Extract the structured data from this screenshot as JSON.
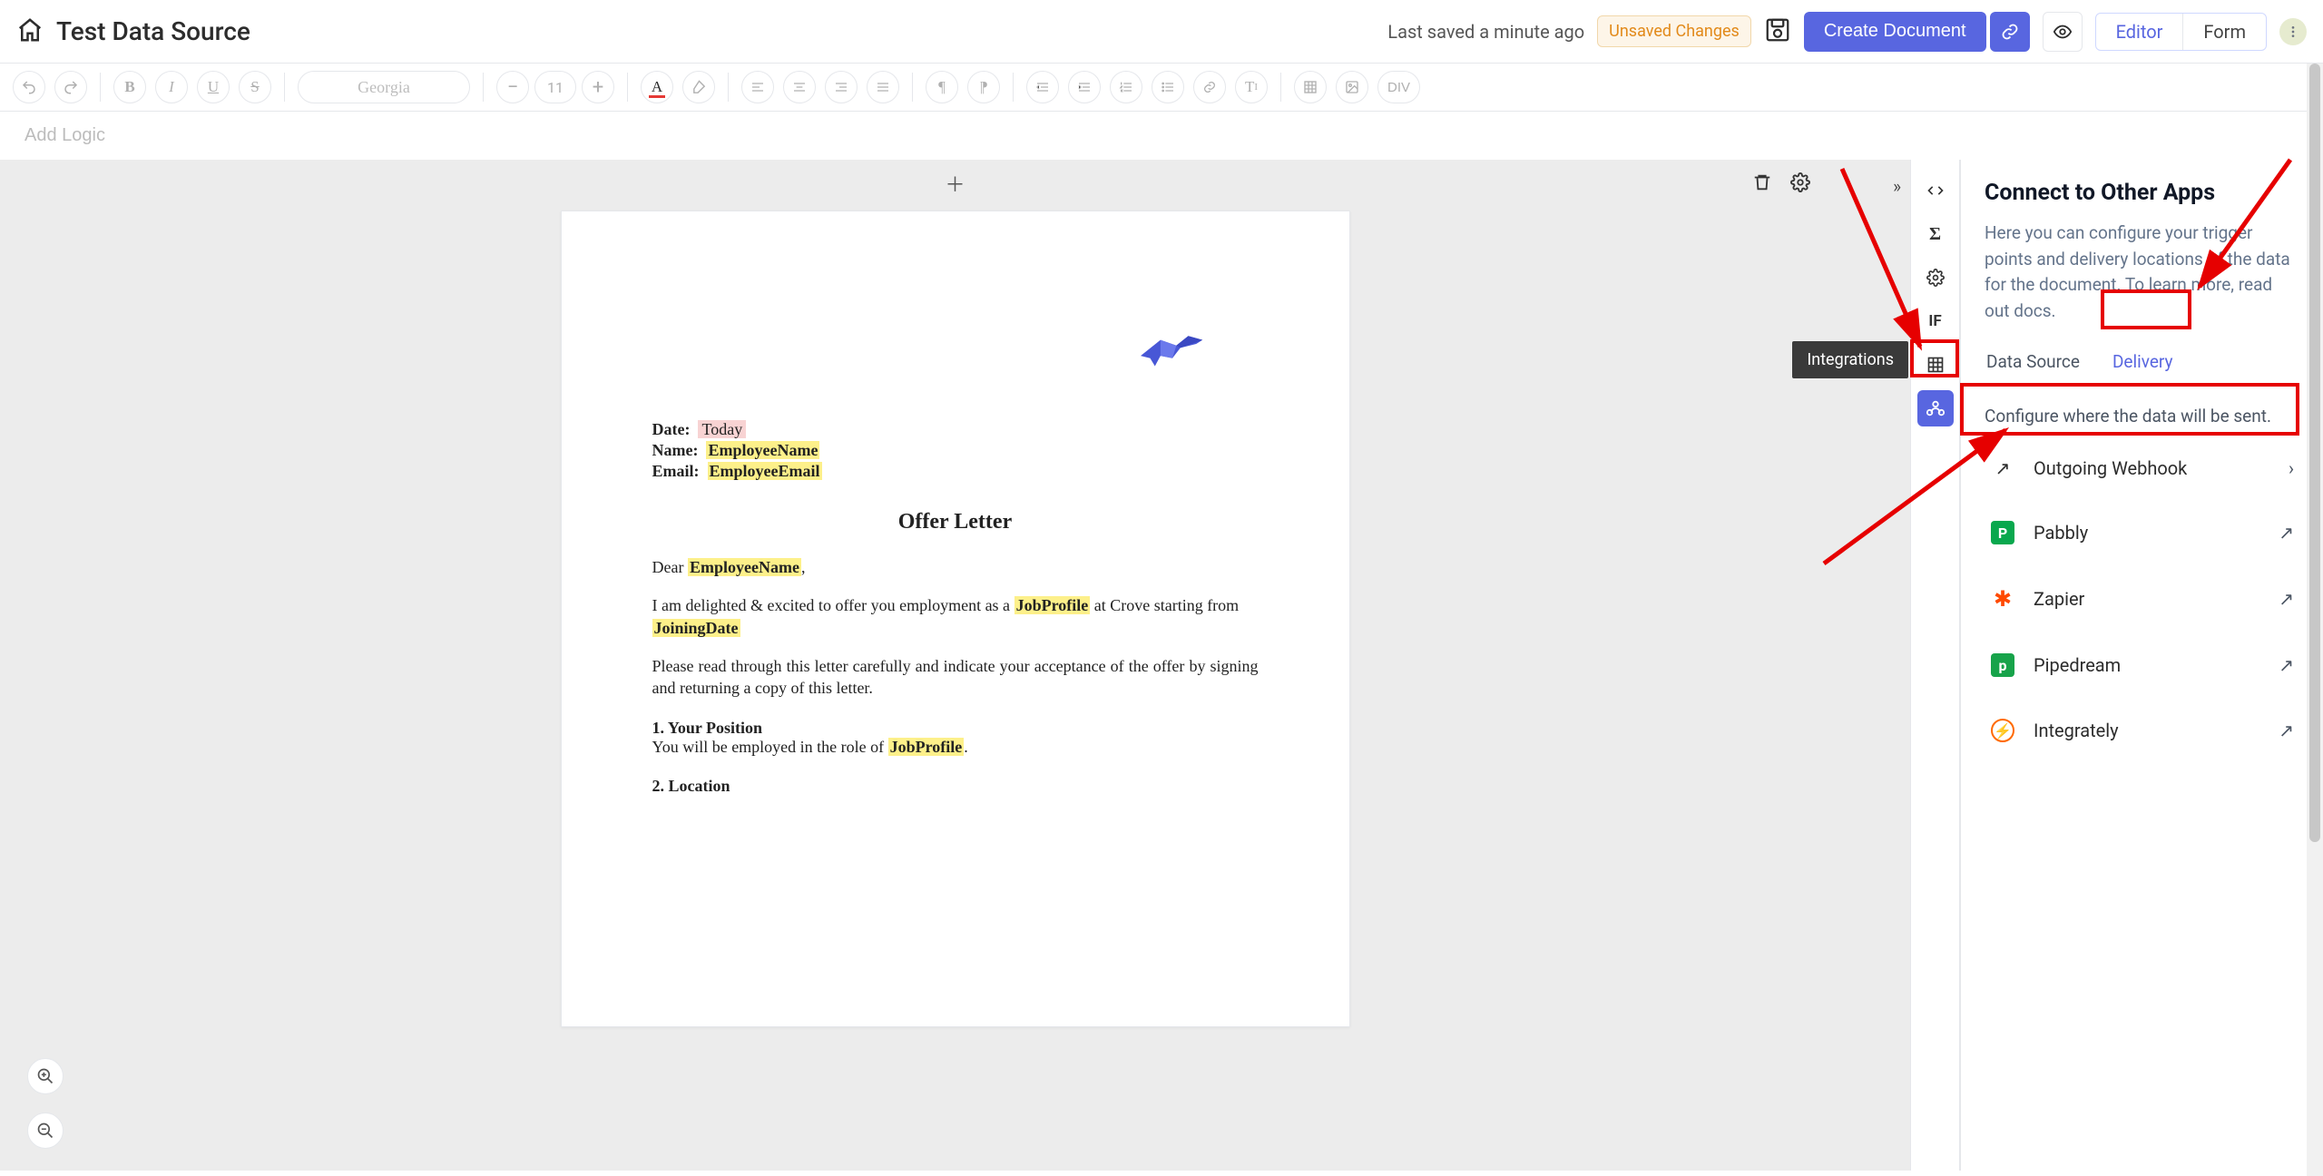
{
  "header": {
    "title": "Test Data Source",
    "last_saved": "Last saved a minute ago",
    "unsaved_badge": "Unsaved Changes",
    "create_button": "Create Document",
    "segmented": {
      "editor": "Editor",
      "form": "Form"
    }
  },
  "toolbar": {
    "font_name": "Georgia",
    "font_size": "11",
    "add_logic": "Add Logic",
    "div_label": "DIV"
  },
  "document": {
    "date_label": "Date:",
    "date_value": "Today",
    "name_label": "Name:",
    "name_value": "EmployeeName",
    "email_label": "Email:",
    "email_value": "EmployeeEmail",
    "title": "Offer Letter",
    "greeting_prefix": "Dear ",
    "greeting_var": "EmployeeName",
    "greeting_suffix": ",",
    "para1_a": "I am delighted & excited to offer you employment as a ",
    "para1_var1": "JobProfile",
    "para1_b": " at Crove starting from ",
    "para1_var2": "JoiningDate",
    "para2": "Please read through this letter carefully and indicate your acceptance of the offer by signing and returning a copy of this letter.",
    "h1": "1. Your Position",
    "h1_line_a": "You will be employed in the role of ",
    "h1_var": "JobProfile",
    "h1_line_b": ".",
    "h2": "2. Location"
  },
  "side_rail": {
    "tooltip": "Integrations",
    "items": [
      "code",
      "sigma",
      "settings",
      "if",
      "table",
      "integrations"
    ]
  },
  "panel": {
    "title": "Connect to Other Apps",
    "description": "Here you can configure your trigger points and delivery locations of the data for the document. To learn more, read out docs.",
    "tabs": {
      "data_source": "Data Source",
      "delivery": "Delivery"
    },
    "configure_text": "Configure where the data will be sent.",
    "integrations": {
      "webhook": "Outgoing Webhook",
      "pabbly": "Pabbly",
      "zapier": "Zapier",
      "pipedream": "Pipedream",
      "integrately": "Integrately"
    }
  }
}
